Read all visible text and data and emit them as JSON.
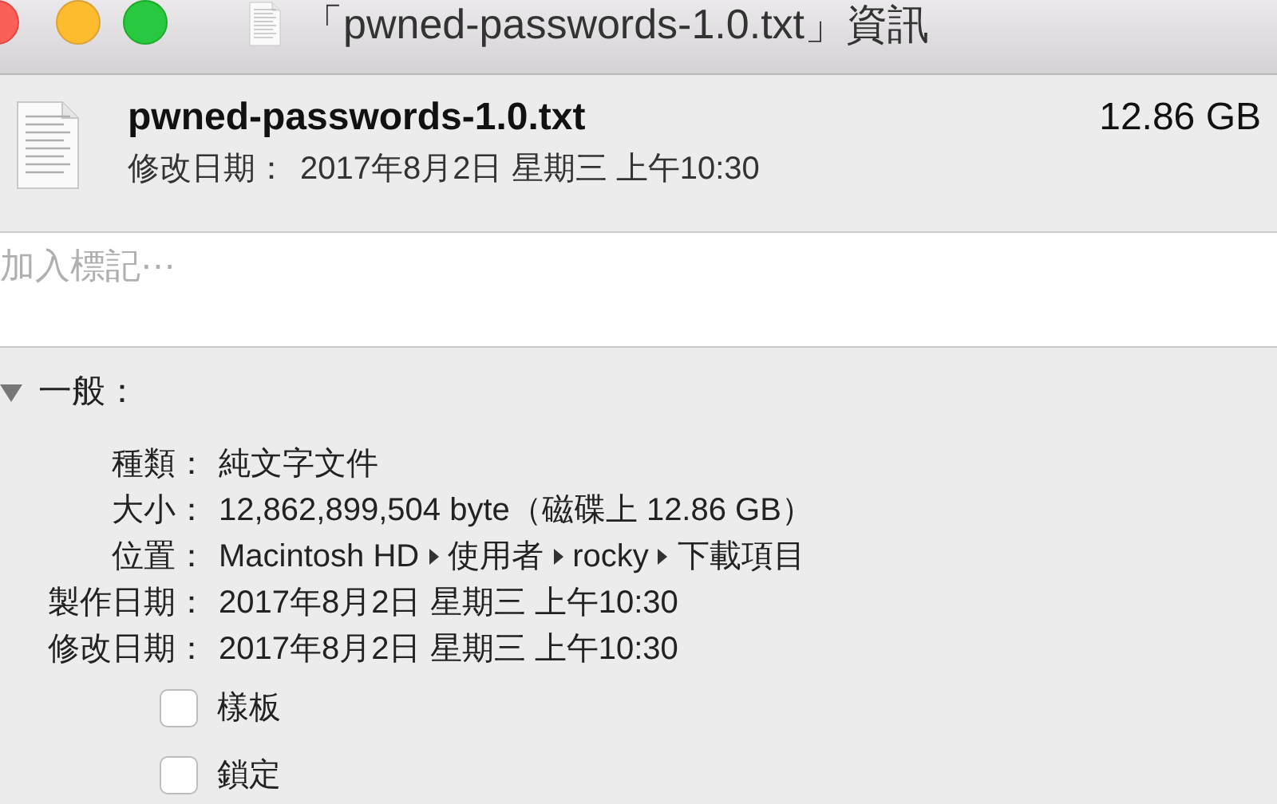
{
  "window": {
    "title": "「pwned-passwords-1.0.txt」資訊"
  },
  "header": {
    "filename": "pwned-passwords-1.0.txt",
    "size": "12.86 GB",
    "modified_label": "修改日期：",
    "modified": "2017年8月2日 星期三 上午10:30"
  },
  "tags": {
    "placeholder": "加入標記⋯"
  },
  "general": {
    "title": "一般：",
    "expanded": true,
    "rows": [
      {
        "label": "種類：",
        "value": "純文字文件"
      },
      {
        "label": "大小：",
        "value": "12,862,899,504 byte（磁碟上 12.86 GB）"
      },
      {
        "label": "位置：",
        "path": [
          "Macintosh HD",
          "使用者",
          "rocky",
          "下載項目"
        ]
      },
      {
        "label": "製作日期：",
        "value": "2017年8月2日 星期三 上午10:30"
      },
      {
        "label": "修改日期：",
        "value": "2017年8月2日 星期三 上午10:30"
      }
    ],
    "checkboxes": [
      {
        "label": "樣板",
        "checked": false
      },
      {
        "label": "鎖定",
        "checked": false
      }
    ]
  }
}
